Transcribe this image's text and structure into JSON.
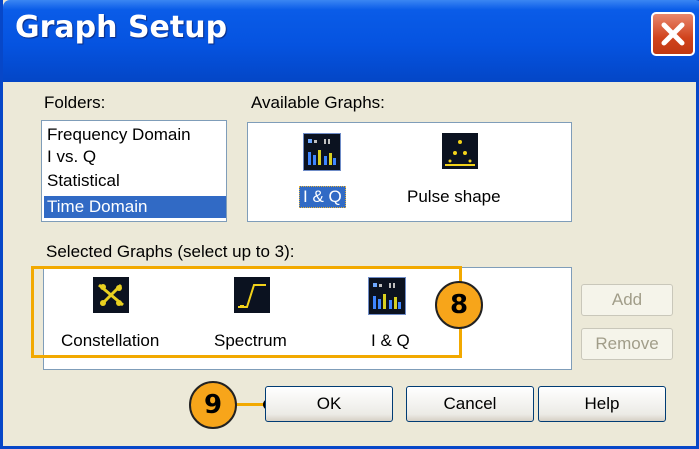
{
  "window": {
    "title": "Graph Setup"
  },
  "folders": {
    "label": "Folders:",
    "items": [
      "Frequency Domain",
      "I vs. Q",
      "Statistical",
      "Time Domain"
    ],
    "selected": "Time Domain"
  },
  "available": {
    "label": "Available Graphs:",
    "items": [
      {
        "label": "I & Q",
        "icon": "iq-graph-icon",
        "selected": true
      },
      {
        "label": "Pulse shape",
        "icon": "pulse-shape-graph-icon",
        "selected": false
      }
    ]
  },
  "selected_graphs": {
    "label": "Selected Graphs (select up to 3):",
    "items": [
      {
        "label": "Constellation",
        "icon": "constellation-graph-icon"
      },
      {
        "label": "Spectrum",
        "icon": "spectrum-graph-icon"
      },
      {
        "label": "I & Q",
        "icon": "iq-graph-icon"
      }
    ]
  },
  "side_buttons": {
    "add": "Add",
    "remove": "Remove"
  },
  "buttons": {
    "ok": "OK",
    "cancel": "Cancel",
    "help": "Help"
  },
  "callouts": {
    "selected_graphs": "8",
    "ok": "9"
  },
  "colors": {
    "titlebar": "#0553e0",
    "selection": "#316ac5",
    "callout": "#f7a51a",
    "close": "#d1431c"
  }
}
